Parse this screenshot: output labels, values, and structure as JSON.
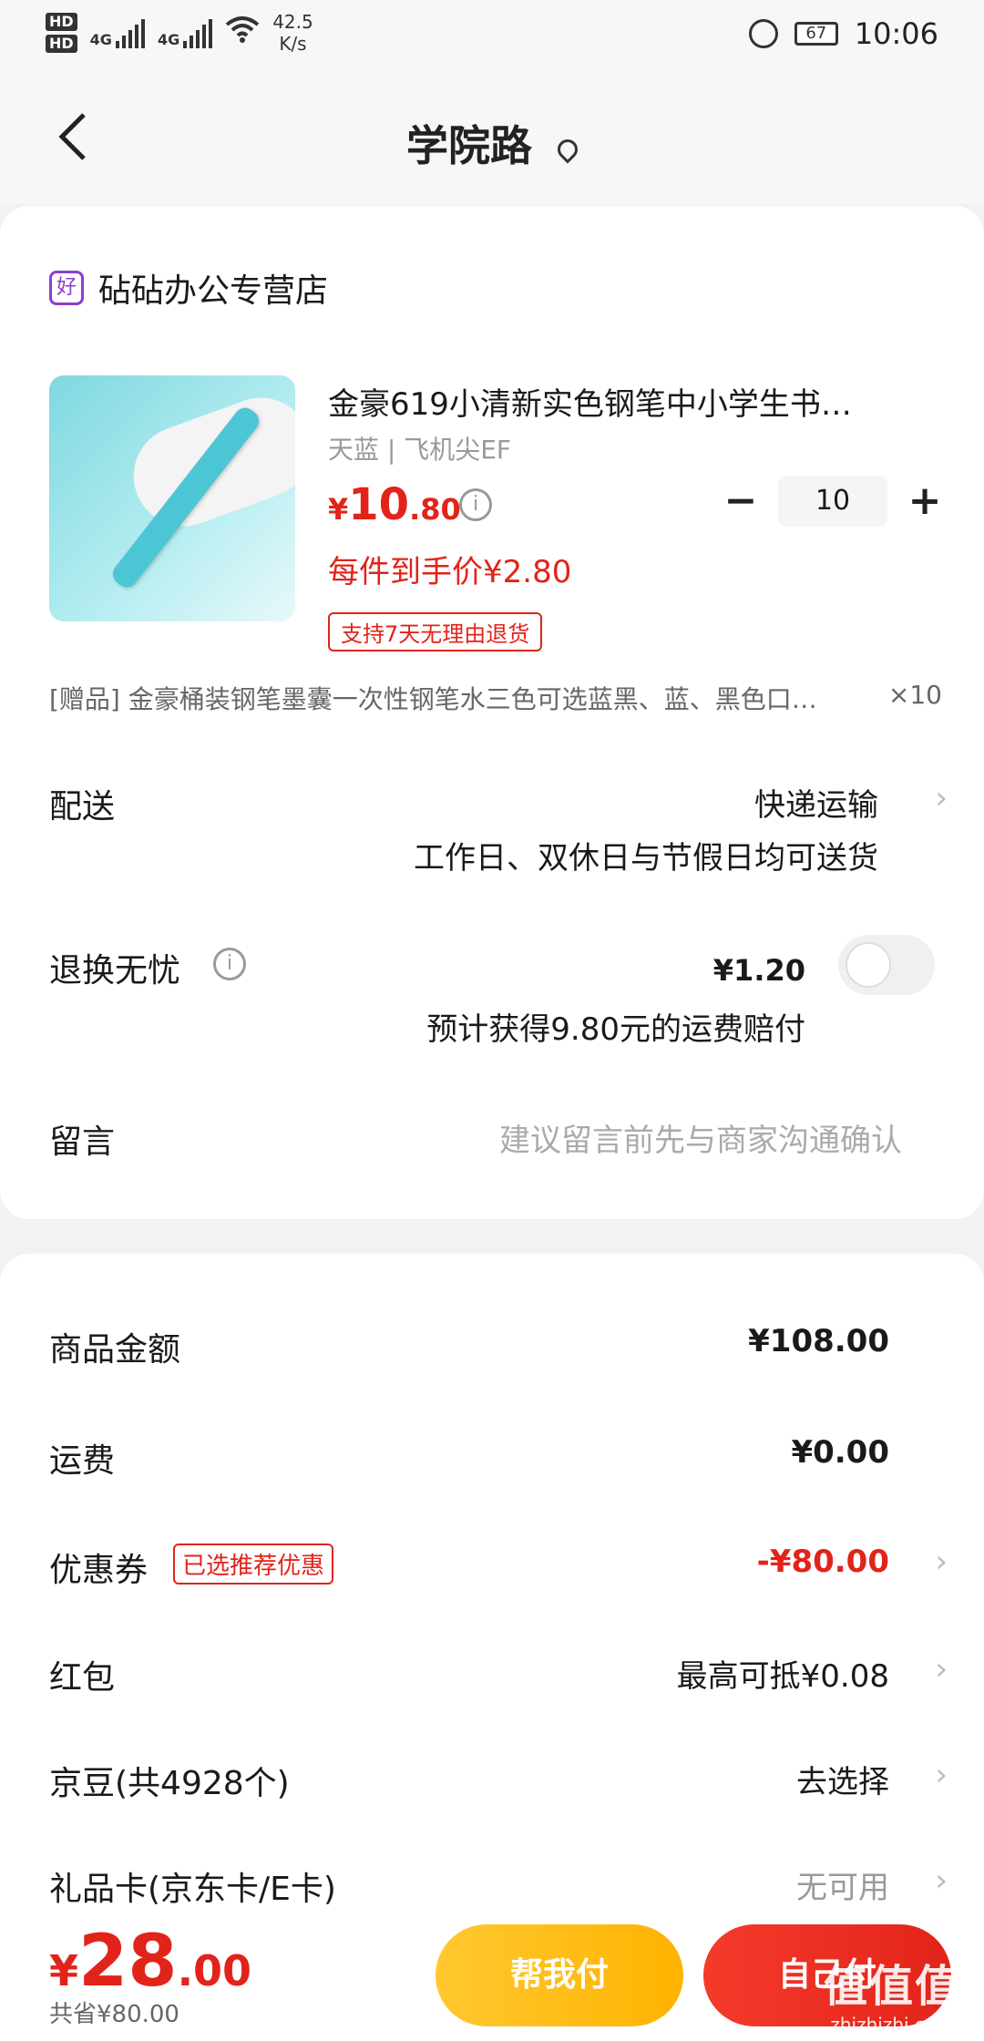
{
  "status_bar": {
    "hd1": "HD",
    "hd2": "HD",
    "net1": "4G",
    "net2": "4G",
    "speed_value": "42.5",
    "speed_unit": "K/s",
    "battery": "67",
    "time": "10:06"
  },
  "header": {
    "back_icon": "chevron-left-icon",
    "title": "学院路",
    "location_icon": "location-pin-icon"
  },
  "shop": {
    "icon_text": "好",
    "name": "砧砧办公专营店"
  },
  "product": {
    "title": "金豪619小清新实色钢笔中小学生书…",
    "spec": "天蓝 | 飞机尖EF",
    "price_currency": "¥",
    "price_int": "10",
    "price_dec": ".80",
    "info_icon": "i",
    "qty_minus": "−",
    "qty_value": "10",
    "qty_plus": "+",
    "unit_price": "每件到手价¥2.80",
    "return_badge": "支持7天无理由退货"
  },
  "gift": {
    "text": "[赠品]  金豪桶装钢笔墨囊一次性钢笔水三色可选蓝黑、蓝、黑色口…",
    "count": "×10"
  },
  "shipping": {
    "label": "配送",
    "value": "快递运输",
    "sub": "工作日、双休日与节假日均可送货"
  },
  "insurance": {
    "label": "退换无忧",
    "info_icon": "i",
    "price": "¥1.20",
    "sub": "预计获得9.80元的运费赔付"
  },
  "message": {
    "label": "留言",
    "placeholder": "建议留言前先与商家沟通确认"
  },
  "summary": [
    {
      "label": "商品金额",
      "value": "¥108.00"
    },
    {
      "label": "运费",
      "value": "¥0.00"
    },
    {
      "label": "优惠券",
      "badge": "已选推荐优惠",
      "value": "-¥80.00"
    },
    {
      "label": "红包",
      "value": "最高可抵¥0.08"
    },
    {
      "label": "京豆(共4928个)",
      "value": "去选择"
    },
    {
      "label": "礼品卡(京东卡/E卡)",
      "value": "无可用"
    }
  ],
  "bottom": {
    "total_currency": "¥",
    "total_int": "28",
    "total_dec": ".00",
    "saved": "共省¥80.00",
    "help_pay": "帮我付",
    "self_pay": "自己付"
  },
  "watermark": {
    "big": "值值值",
    "small": "zhizhizhi.com"
  },
  "chevron": "›",
  "colors": {
    "accent": "#e2231a",
    "help_btn": "#ffb300"
  }
}
